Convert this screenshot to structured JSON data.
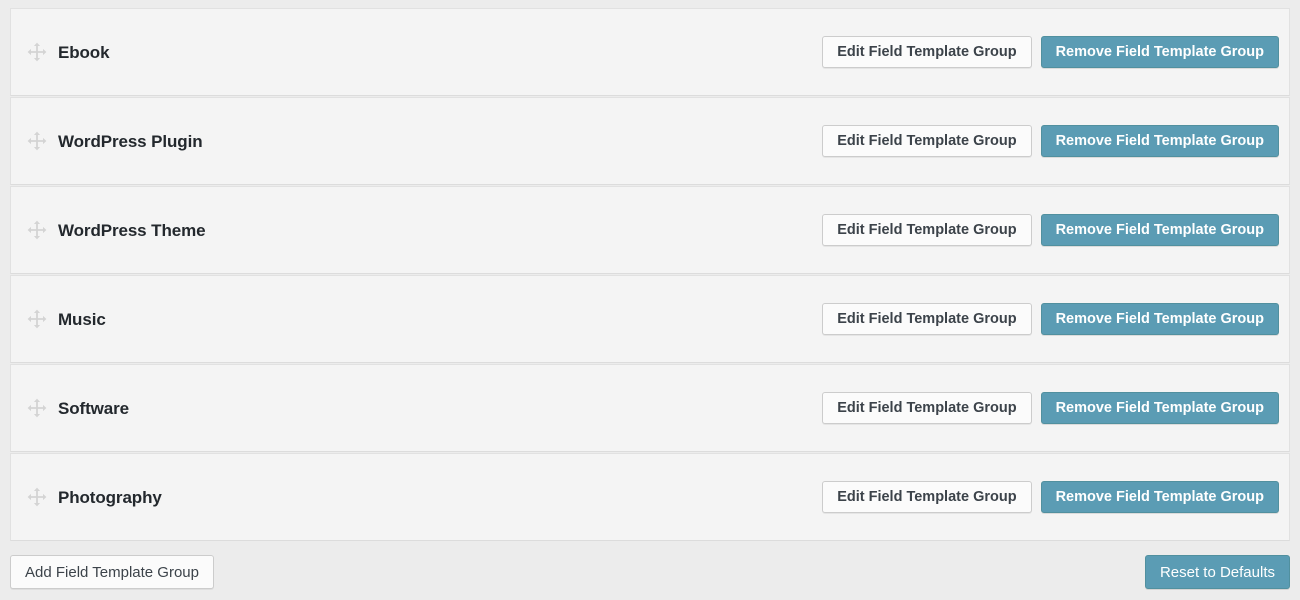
{
  "colors": {
    "page_background": "#ececec",
    "row_background": "#f4f4f4",
    "row_border": "#e1e1e1",
    "primary_button": "#5b9cb4",
    "primary_button_border": "#51909f",
    "secondary_button": "#fbfbfb",
    "secondary_button_border": "#cccccc",
    "title_text": "#23282d",
    "button_text": "#3c434a",
    "drag_handle": "#cfcfcf"
  },
  "groups": [
    {
      "label": "Ebook",
      "drag_handle_icon": "move-icon",
      "edit_label": "Edit Field Template Group",
      "remove_label": "Remove Field Template Group"
    },
    {
      "label": "WordPress Plugin",
      "drag_handle_icon": "move-icon",
      "edit_label": "Edit Field Template Group",
      "remove_label": "Remove Field Template Group"
    },
    {
      "label": "WordPress Theme",
      "drag_handle_icon": "move-icon",
      "edit_label": "Edit Field Template Group",
      "remove_label": "Remove Field Template Group"
    },
    {
      "label": "Music",
      "drag_handle_icon": "move-icon",
      "edit_label": "Edit Field Template Group",
      "remove_label": "Remove Field Template Group"
    },
    {
      "label": "Software",
      "drag_handle_icon": "move-icon",
      "edit_label": "Edit Field Template Group",
      "remove_label": "Remove Field Template Group"
    },
    {
      "label": "Photography",
      "drag_handle_icon": "move-icon",
      "edit_label": "Edit Field Template Group",
      "remove_label": "Remove Field Template Group"
    }
  ],
  "footer": {
    "add_label": "Add Field Template Group",
    "reset_label": "Reset to Defaults"
  }
}
